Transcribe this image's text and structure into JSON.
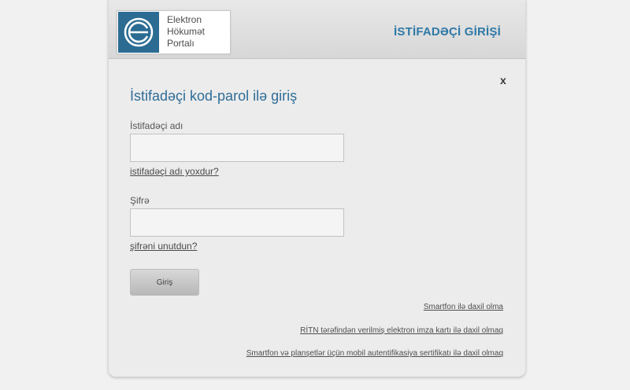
{
  "header": {
    "logo_lines": [
      "Elektron",
      "Hökumət",
      "Portalı"
    ],
    "title": "İSTİFADƏÇİ GİRİŞİ"
  },
  "dialog": {
    "close_label": "x",
    "title": "İstifadəçi kod-parol ilə giriş",
    "username": {
      "label": "İstifadəçi adı",
      "value": "",
      "link": "istifadəçi adı yoxdur?"
    },
    "password": {
      "label": "Şifrə",
      "value": "",
      "link": "şifrəni unutdun?"
    },
    "submit_label": "Giriş",
    "alt_logins": [
      "Smartfon ilə daxil olma",
      "RİTN tərəfindən verilmiş elektron imza kartı ilə daxil olmaq",
      "Smartfon və planşetlər üçün mobil autentifikasiya sertifikatı ilə daxil olmaq"
    ]
  },
  "colors": {
    "brand_blue": "#2c6c92",
    "title_blue": "#2f79a6"
  },
  "icons": {
    "logo": "portal-e-logo-icon"
  }
}
